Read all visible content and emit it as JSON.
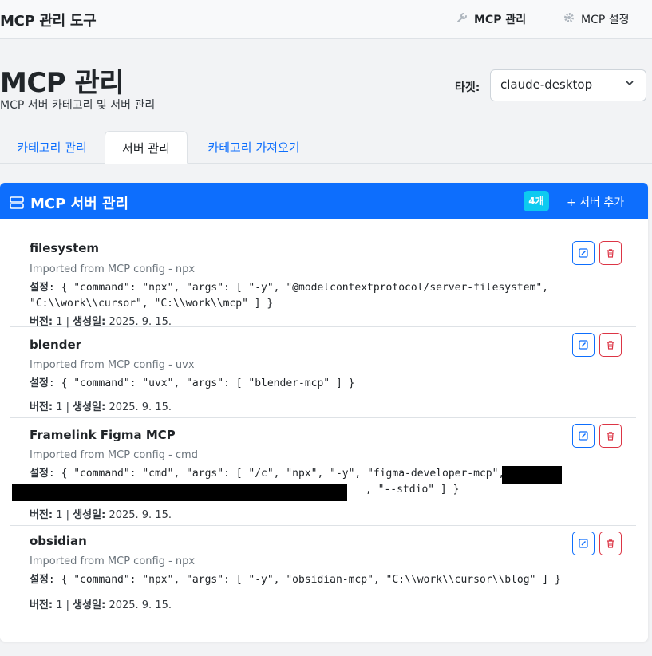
{
  "app": {
    "brand": "MCP 관리 도구"
  },
  "nav": {
    "items": [
      {
        "label": "MCP 관리",
        "icon": "wrench-icon",
        "active": true
      },
      {
        "label": "MCP 설정",
        "icon": "gear-icon",
        "active": false
      }
    ]
  },
  "header": {
    "title": "MCP 관리",
    "subtitle": "MCP 서버 카테고리 및 서버 관리",
    "target_label": "타겟:",
    "target_value": "claude-desktop"
  },
  "tabs": [
    {
      "label": "카테고리 관리",
      "active": false
    },
    {
      "label": "서버 관리",
      "active": true
    },
    {
      "label": "카테고리 가져오기",
      "active": false
    }
  ],
  "card": {
    "title": "MCP 서버 관리",
    "count": "4개",
    "add_label": "+ 서버 추가",
    "accent": "#0d6efd"
  },
  "labels": {
    "config": "설정",
    "version": "버전:",
    "created": "생성일:"
  },
  "servers": [
    {
      "name": "filesystem",
      "desc": "Imported from MCP config - npx",
      "config_line1": ": { \"command\": \"npx\", \"args\": [ \"-y\", \"@modelcontextprotocol/server-filesystem\",",
      "config_line2": "\"C:\\\\work\\\\cursor\", \"C:\\\\work\\\\mcp\" ] }",
      "version": "1",
      "created": "2025. 9. 15."
    },
    {
      "name": "blender",
      "desc": "Imported from MCP config - uvx",
      "config_line1": ": { \"command\": \"uvx\", \"args\": [ \"blender-mcp\" ] }",
      "version": "1",
      "created": "2025. 9. 15."
    },
    {
      "name": "Framelink Figma MCP",
      "desc": "Imported from MCP config - cmd",
      "config_line1": ": { \"command\": \"cmd\", \"args\": [ \"/c\", \"npx\", \"-y\", \"figma-developer-mcp\", \"-",
      "config_line2": ", \"--stdio\" ] }",
      "version": "1",
      "created": "2025. 9. 15."
    },
    {
      "name": "obsidian",
      "desc": "Imported from MCP config - npx",
      "config_line1": ": { \"command\": \"npx\", \"args\": [ \"-y\", \"obsidian-mcp\", \"C:\\\\work\\\\cursor\\\\blog\" ] }",
      "version": "1",
      "created": "2025. 9. 15."
    }
  ]
}
